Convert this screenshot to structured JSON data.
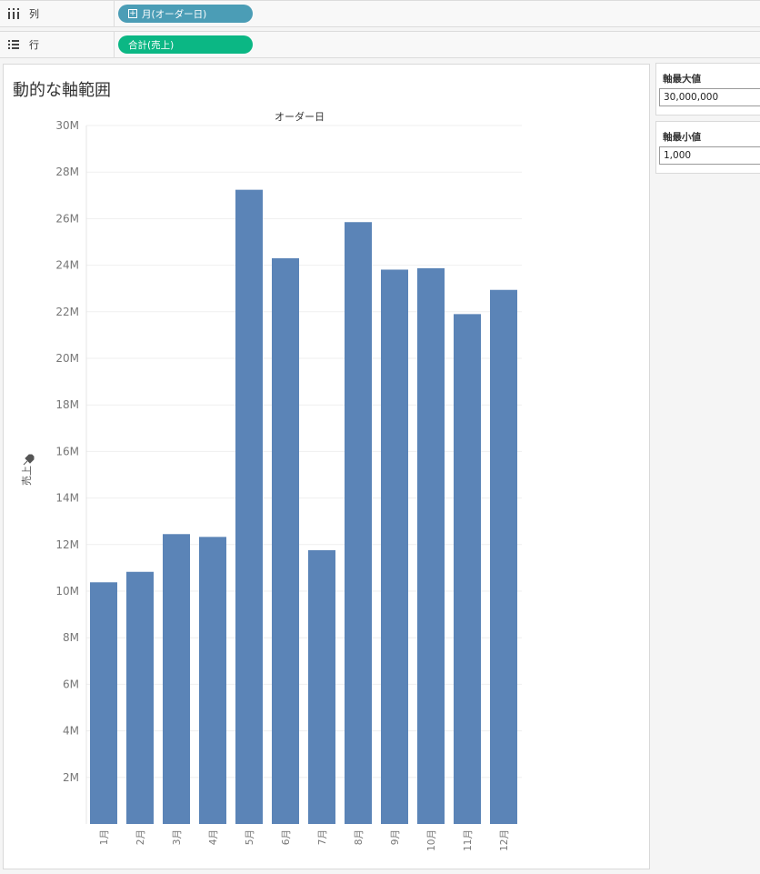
{
  "shelves": {
    "columns": {
      "label": "列",
      "pill": "月(オーダー日)",
      "pill_color": "#4b9db6"
    },
    "rows": {
      "label": "行",
      "pill": "合計(売上)",
      "pill_color": "#0bb784"
    }
  },
  "sheet": {
    "title": "動的な軸範囲"
  },
  "parameters": {
    "max": {
      "title": "軸最大値",
      "value": "30,000,000"
    },
    "min": {
      "title": "軸最小値",
      "value": "1,000"
    }
  },
  "chart_data": {
    "type": "bar",
    "header": "オーダー日",
    "ylabel": "売上",
    "categories": [
      "1月",
      "2月",
      "3月",
      "4月",
      "5月",
      "6月",
      "7月",
      "8月",
      "9月",
      "10月",
      "11月",
      "12月"
    ],
    "values": [
      10380000,
      10830000,
      12450000,
      12330000,
      27240000,
      24300000,
      11760000,
      25850000,
      23810000,
      23870000,
      21900000,
      22940000
    ],
    "ylim": [
      0,
      30000000
    ],
    "yticks": [
      2000000,
      4000000,
      6000000,
      8000000,
      10000000,
      12000000,
      14000000,
      16000000,
      18000000,
      20000000,
      22000000,
      24000000,
      26000000,
      28000000,
      30000000
    ],
    "ytick_labels": [
      "2M",
      "4M",
      "6M",
      "8M",
      "10M",
      "12M",
      "14M",
      "16M",
      "18M",
      "20M",
      "22M",
      "24M",
      "26M",
      "28M",
      "30M"
    ],
    "bar_color": "#5b84b7",
    "grid": true
  }
}
